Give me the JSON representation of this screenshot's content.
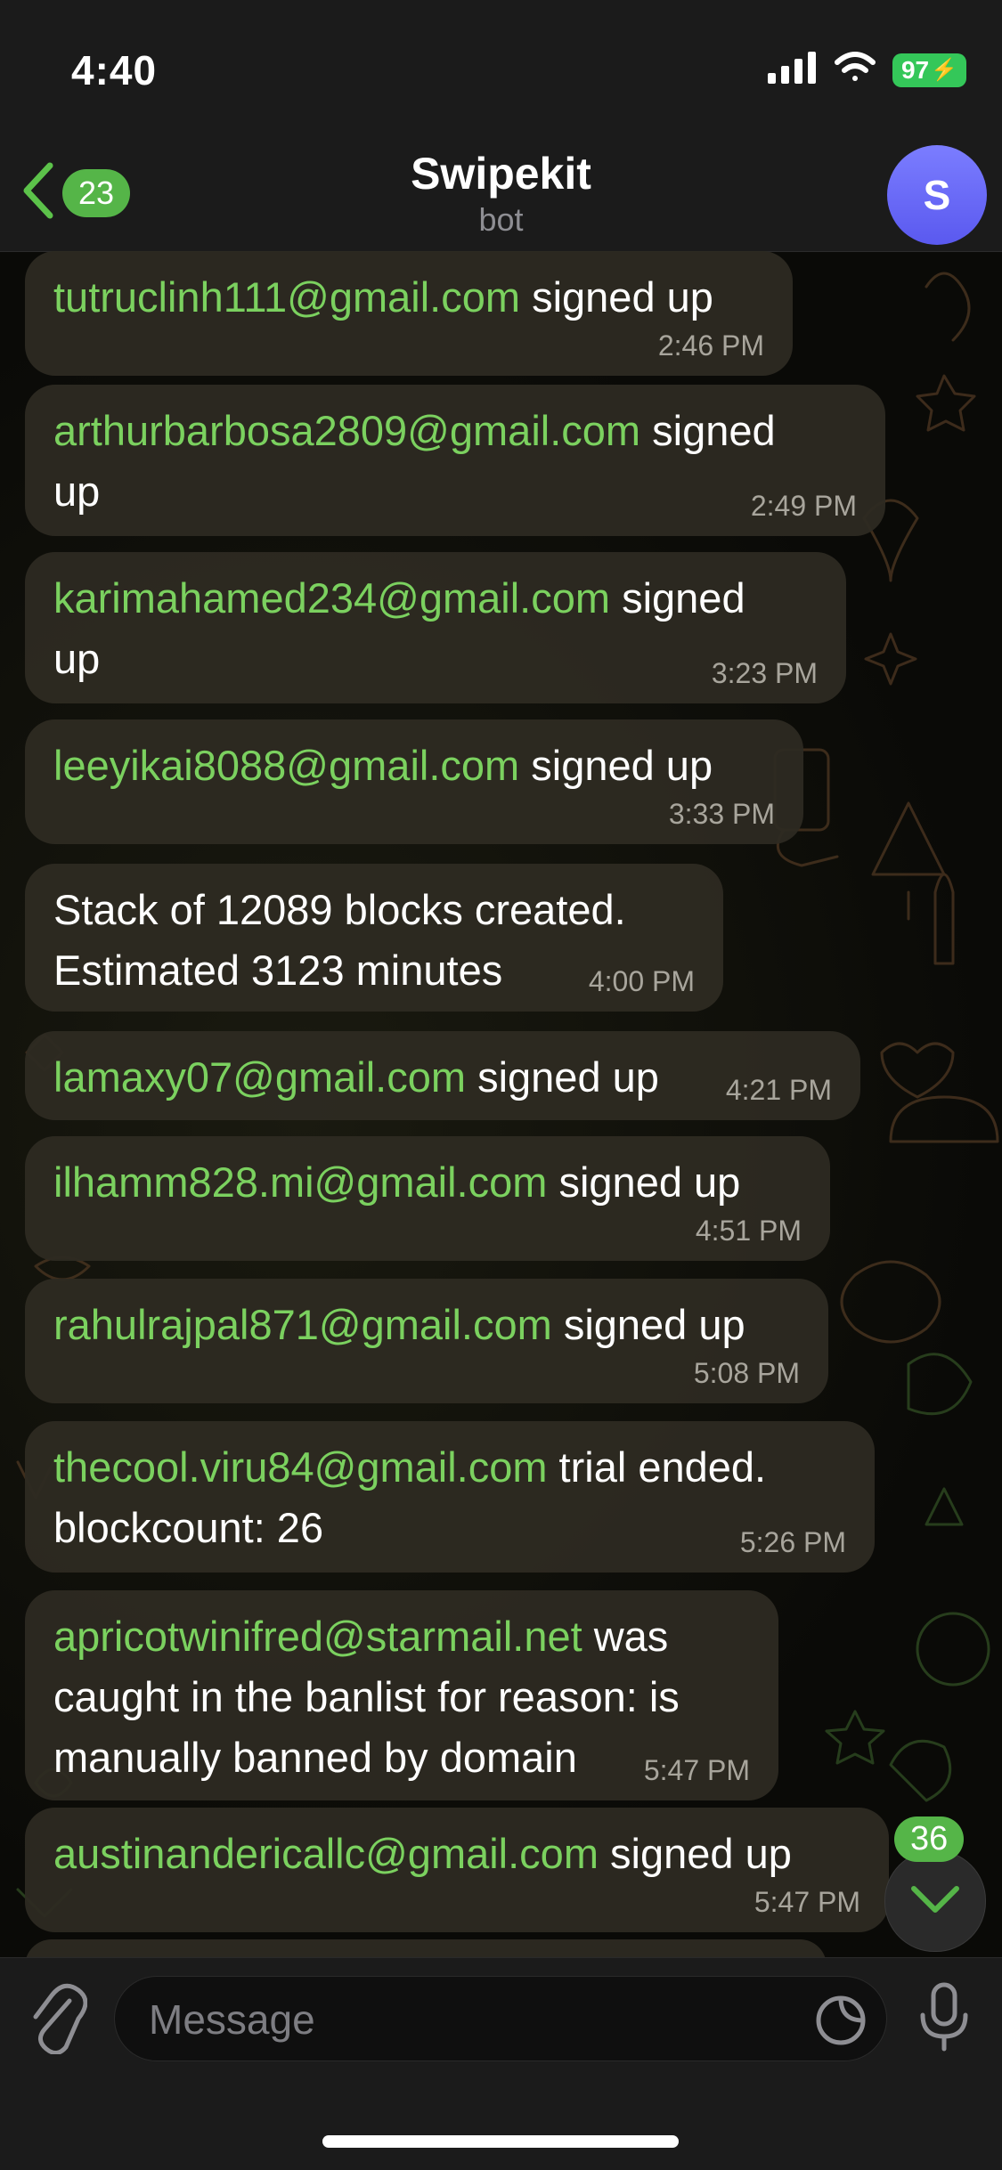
{
  "status": {
    "time": "4:40",
    "battery": "97"
  },
  "header": {
    "back_count": "23",
    "title": "Swipekit",
    "subtitle": "bot",
    "avatar_letter": "S"
  },
  "messages": [
    {
      "email": "tutruclinh111@gmail.com",
      "text": " signed up",
      "time": "2:46 PM"
    },
    {
      "email": "arthurbarbosa2809@gmail.com",
      "text": " signed",
      "text2": "up",
      "time": "2:49 PM"
    },
    {
      "email": "karimahamed234@gmail.com",
      "text": " signed",
      "text2": "up",
      "time": "3:23 PM"
    },
    {
      "email": "leeyikai8088@gmail.com",
      "text": " signed up",
      "time": "3:33 PM"
    },
    {
      "email": "",
      "text": "Stack of 12089 blocks created.",
      "text2": "Estimated 3123 minutes",
      "time": "4:00 PM"
    },
    {
      "email": "lamaxy07@gmail.com",
      "text": " signed up",
      "time": "4:21 PM"
    },
    {
      "email": "ilhamm828.mi@gmail.com",
      "text": " signed up",
      "time": "4:51 PM"
    },
    {
      "email": "rahulrajpal871@gmail.com",
      "text": " signed up",
      "time": "5:08 PM"
    },
    {
      "email": "thecool.viru84@gmail.com",
      "text": " trial ended.",
      "text2": "blockcount: 26",
      "time": "5:26 PM"
    },
    {
      "email": "apricotwinifred@starmail.net",
      "text": " was",
      "text2": "caught in the banlist for reason: is",
      "text3": "manually banned by domain",
      "time": "5:47 PM"
    },
    {
      "email": "austinandericallc@gmail.com",
      "text": " signed up",
      "time": "5:47 PM"
    }
  ],
  "scroll_badge": "36",
  "composer": {
    "placeholder": "Message"
  },
  "icons": [
    "chevron-left-icon",
    "signal-icon",
    "wifi-icon",
    "battery-icon",
    "paperclip-icon",
    "sticker-icon",
    "microphone-icon",
    "chevron-down-icon"
  ]
}
